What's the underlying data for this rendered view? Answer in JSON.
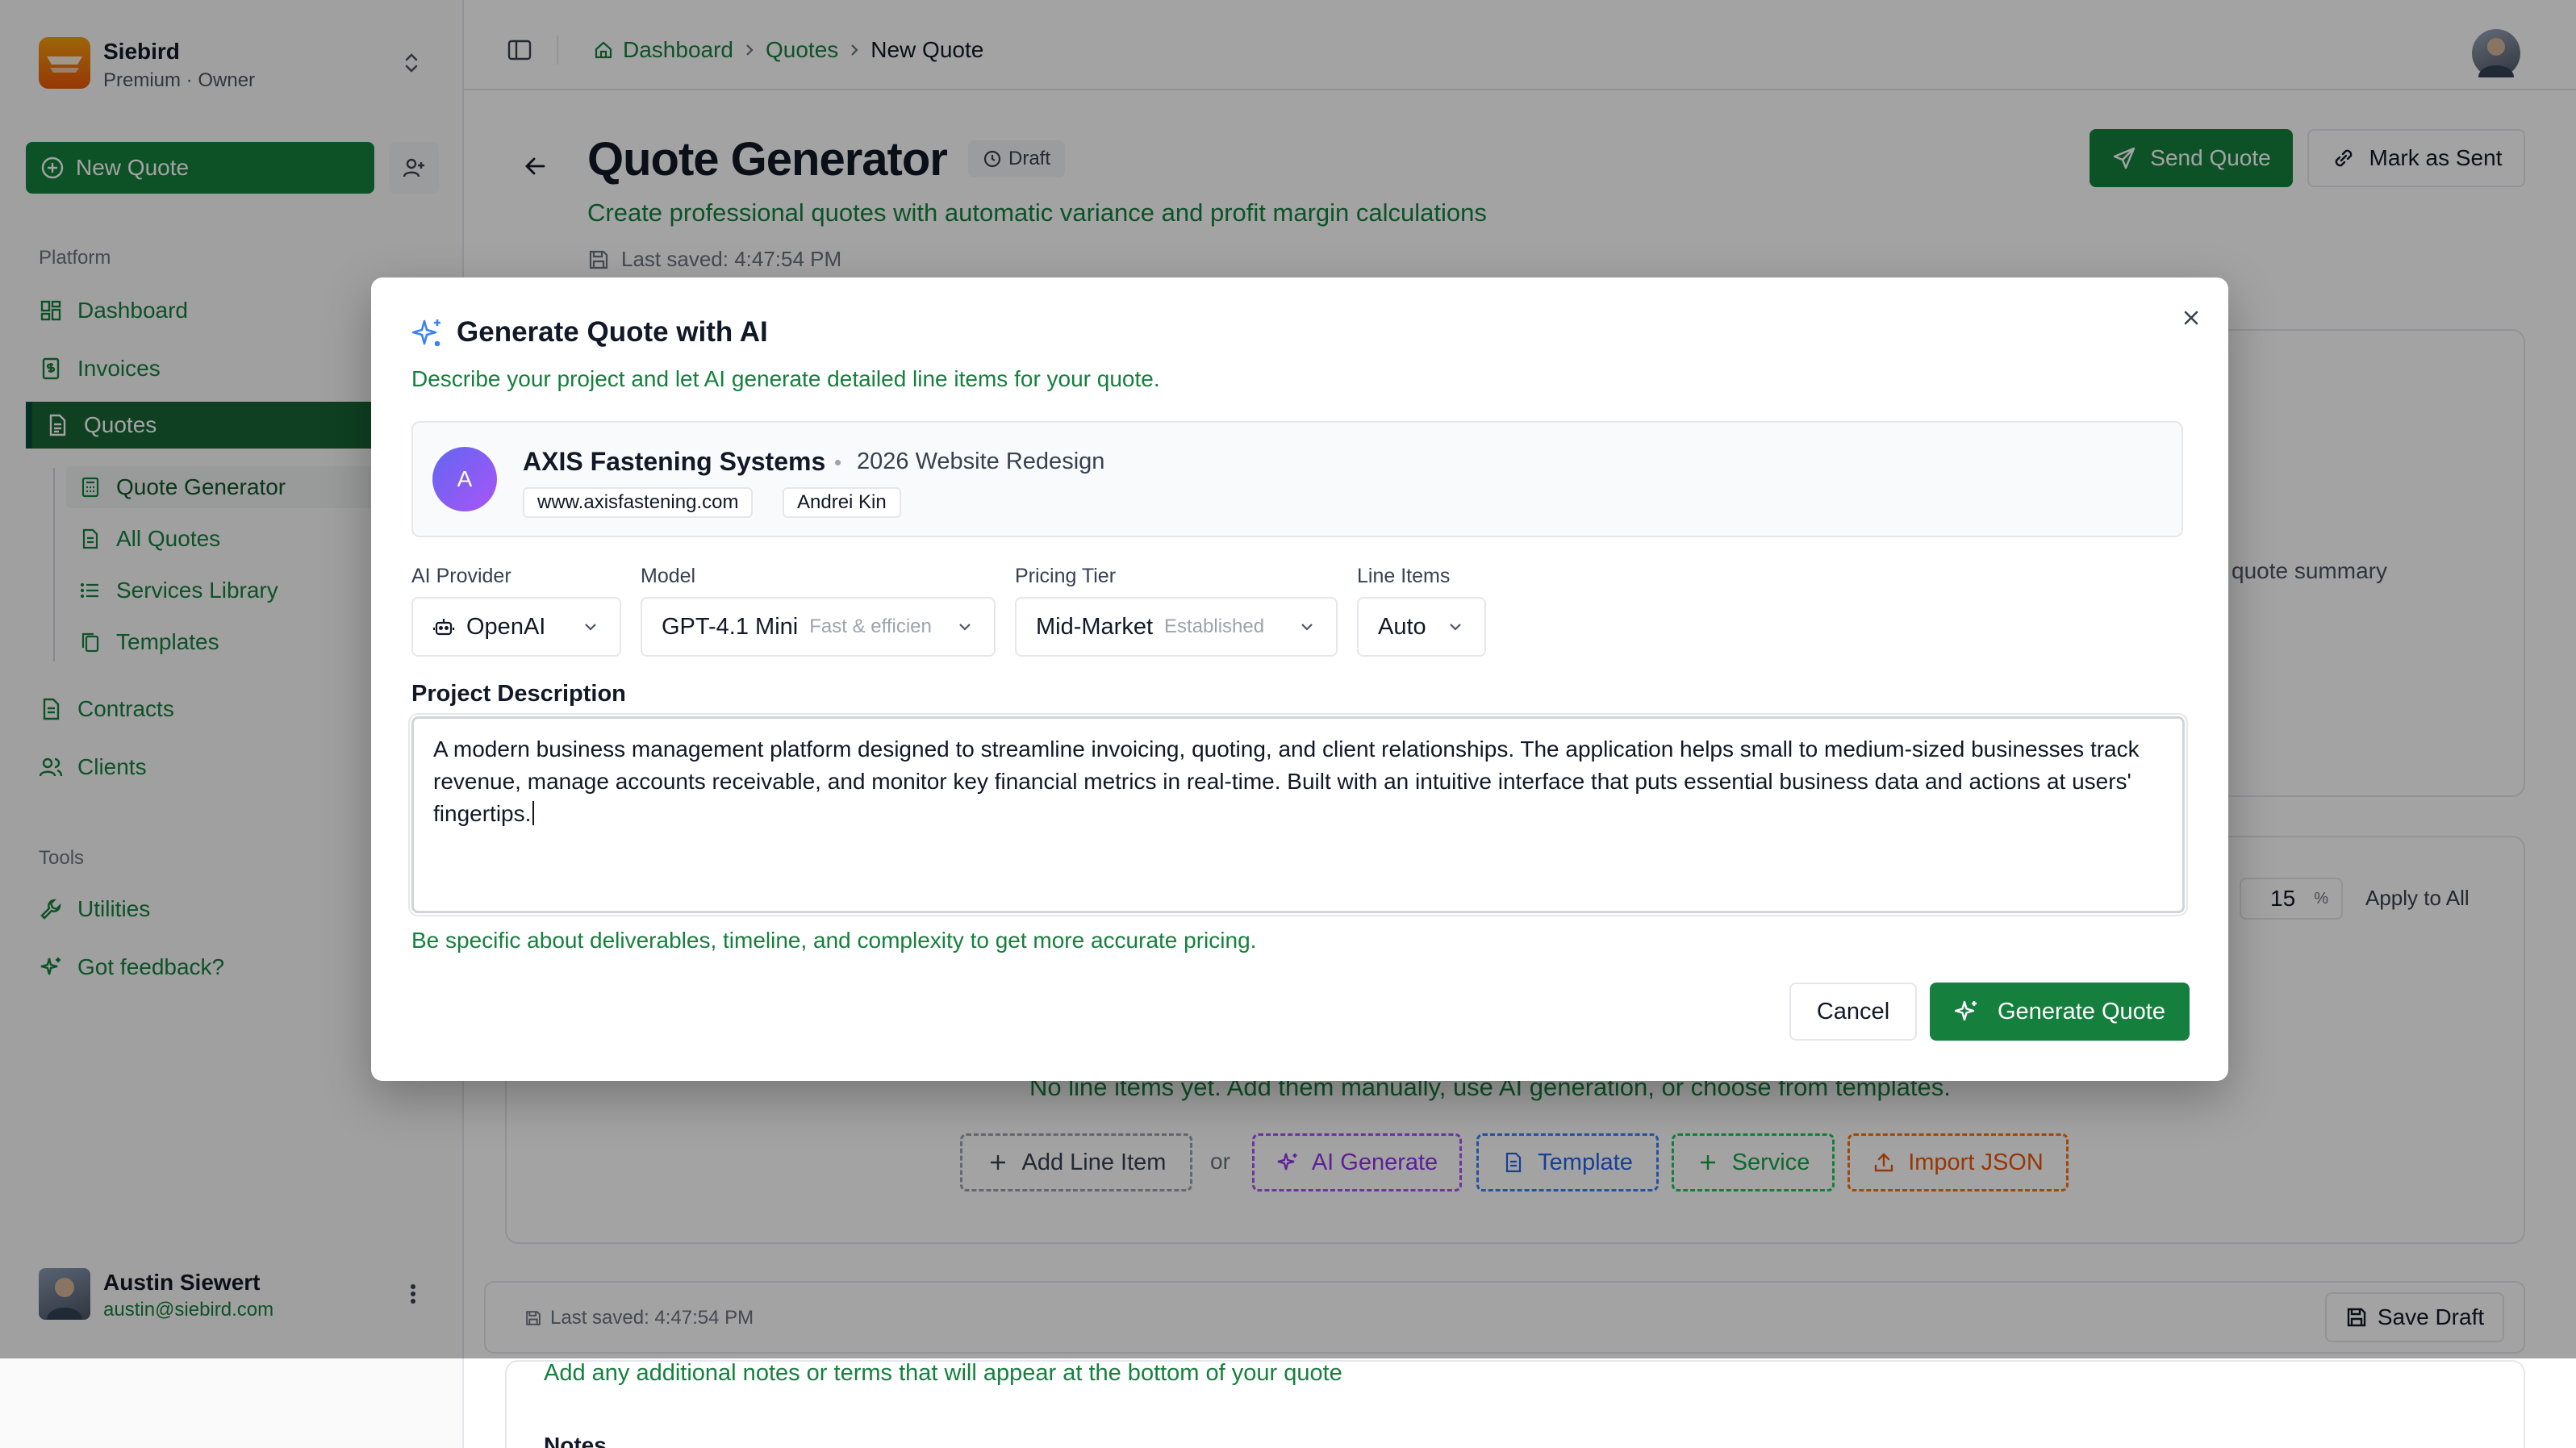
{
  "workspace": {
    "name": "Siebird",
    "plan": "Premium · Owner"
  },
  "sidebar": {
    "new_quote_label": "New Quote",
    "platform_label": "Platform",
    "tools_label": "Tools",
    "items": {
      "dashboard": "Dashboard",
      "invoices": "Invoices",
      "quotes": "Quotes",
      "contracts": "Contracts",
      "clients": "Clients",
      "utilities": "Utilities",
      "feedback": "Got feedback?"
    },
    "quotes_sub": {
      "generator": "Quote Generator",
      "all": "All Quotes",
      "services": "Services Library",
      "templates": "Templates"
    },
    "user": {
      "name": "Austin Siewert",
      "email": "austin@siebird.com"
    }
  },
  "breadcrumb": {
    "home": "Dashboard",
    "section": "Quotes",
    "current": "New Quote"
  },
  "page": {
    "title": "Quote Generator",
    "status": "Draft",
    "subtitle": "Create professional quotes with automatic variance and profit margin calculations",
    "last_saved": "Last saved: 4:47:54 PM",
    "send_label": "Send Quote",
    "mark_sent_label": "Mark as Sent",
    "summary_hint": "quote summary",
    "margin_value": "15",
    "margin_unit": "%",
    "apply_all": "Apply to All",
    "empty_message": "No line items yet. Add them manually, use AI generation, or choose from templates.",
    "actions": {
      "add": "Add Line Item",
      "or": "or",
      "ai": "AI Generate",
      "template": "Template",
      "service": "Service",
      "import": "Import JSON"
    },
    "footer_saved": "Last saved: 4:47:54 PM",
    "save_draft": "Save Draft",
    "notes_sub": "Add any additional notes or terms that will appear at the bottom of your quote",
    "notes_label": "Notes"
  },
  "modal": {
    "title": "Generate Quote with AI",
    "subtitle": "Describe your project and let AI generate detailed line items for your quote.",
    "client": {
      "initial": "A",
      "name": "AXIS Fastening Systems",
      "separator": "•",
      "project": "2026 Website Redesign",
      "website": "www.axisfastening.com",
      "contact": "Andrei Kin"
    },
    "fields": {
      "provider_label": "AI Provider",
      "provider_value": "OpenAI",
      "model_label": "Model",
      "model_value": "GPT-4.1 Mini",
      "model_hint": "Fast & efficien",
      "tier_label": "Pricing Tier",
      "tier_value": "Mid-Market",
      "tier_hint": "Established",
      "items_label": "Line Items",
      "items_value": "Auto"
    },
    "description_label": "Project Description",
    "description": "A modern business management platform designed to streamline invoicing, quoting, and client relationships. The application helps small to medium-sized businesses track revenue, manage accounts receivable, and monitor key financial metrics in real-time. Built with an intuitive interface that puts essential business data and actions at users' fingertips.",
    "hint": "Be specific about deliverables, timeline, and complexity to get more accurate pricing.",
    "cancel_label": "Cancel",
    "generate_label": "Generate Quote"
  }
}
